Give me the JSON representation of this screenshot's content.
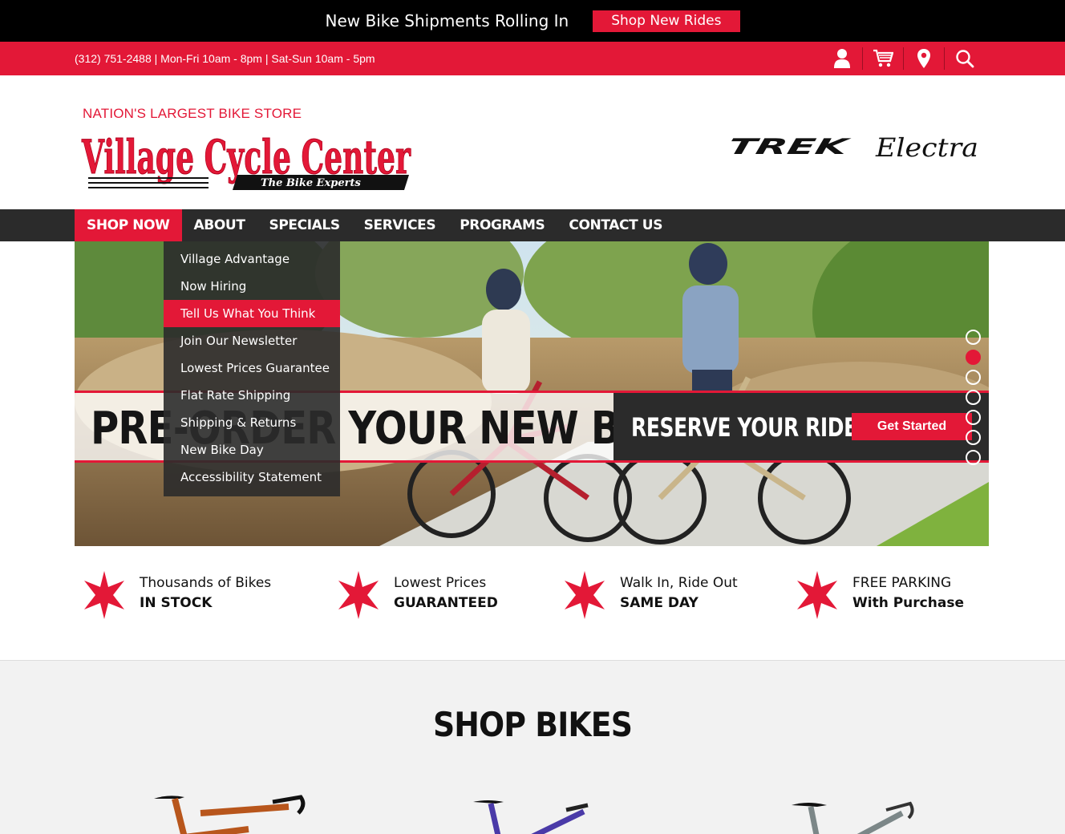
{
  "promo": {
    "text": "New Bike Shipments Rolling In",
    "button": "Shop New Rides"
  },
  "info": {
    "hours": "(312) 751-2488 | Mon-Fri 10am - 8pm | Sat-Sun 10am - 5pm"
  },
  "utility_icons": [
    "account-icon",
    "cart-icon",
    "location-pin-icon",
    "search-icon"
  ],
  "header": {
    "tagline": "NATION'S LARGEST BIKE STORE",
    "logo_text": "Village Cycle Center",
    "logo_sub": "The Bike Experts",
    "brands": [
      "TREK",
      "Electra"
    ]
  },
  "nav": {
    "items": [
      "SHOP NOW",
      "ABOUT",
      "SPECIALS",
      "SERVICES",
      "PROGRAMS",
      "CONTACT US"
    ]
  },
  "dropdown": {
    "items": [
      "Village Advantage",
      "Now Hiring",
      "Tell Us What You Think",
      "Join Our Newsletter",
      "Lowest Prices Guarantee",
      "Flat Rate Shipping",
      "Shipping & Returns",
      "New Bike Day",
      "Accessibility Statement"
    ]
  },
  "hero": {
    "headline": "PRE-ORDER YOUR NEW BIKE",
    "subhead": "RESERVE YOUR RIDE",
    "cta": "Get Started",
    "slide_count": 7,
    "active_slide": 2
  },
  "features": [
    {
      "line1": "Thousands of Bikes",
      "line2": "IN STOCK"
    },
    {
      "line1": "Lowest Prices",
      "line2": "GUARANTEED"
    },
    {
      "line1": "Walk In, Ride Out",
      "line2": "SAME DAY"
    },
    {
      "line1": "FREE PARKING",
      "line2": "With Purchase"
    }
  ],
  "shop": {
    "title": "SHOP BIKES"
  },
  "colors": {
    "brand_red": "#e31837",
    "nav_dark": "#2b2b2b",
    "promo_black": "#000000"
  }
}
